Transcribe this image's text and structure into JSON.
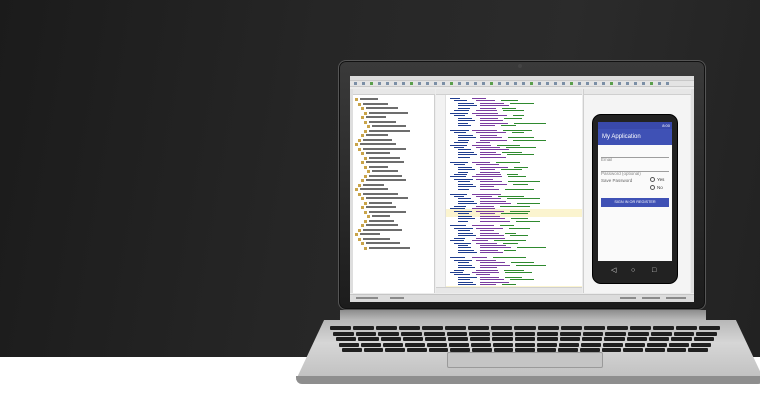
{
  "phone_app": {
    "status_time": "8:00",
    "app_title": "My Application",
    "email_placeholder": "Email",
    "password_placeholder": "Password (optional)",
    "save_password_label": "Save Password",
    "radio_yes": "Yes",
    "radio_no": "No",
    "sign_in_button": "SIGN IN OR REGISTER"
  },
  "phone_nav": {
    "back_glyph": "◁",
    "home_glyph": "○",
    "recents_glyph": "□"
  },
  "colors": {
    "app_primary": "#3f51b5",
    "background_dark": "#262626",
    "floor": "#ffffff"
  },
  "icons": [
    "camera-icon",
    "back-icon",
    "home-icon",
    "recents-icon"
  ]
}
